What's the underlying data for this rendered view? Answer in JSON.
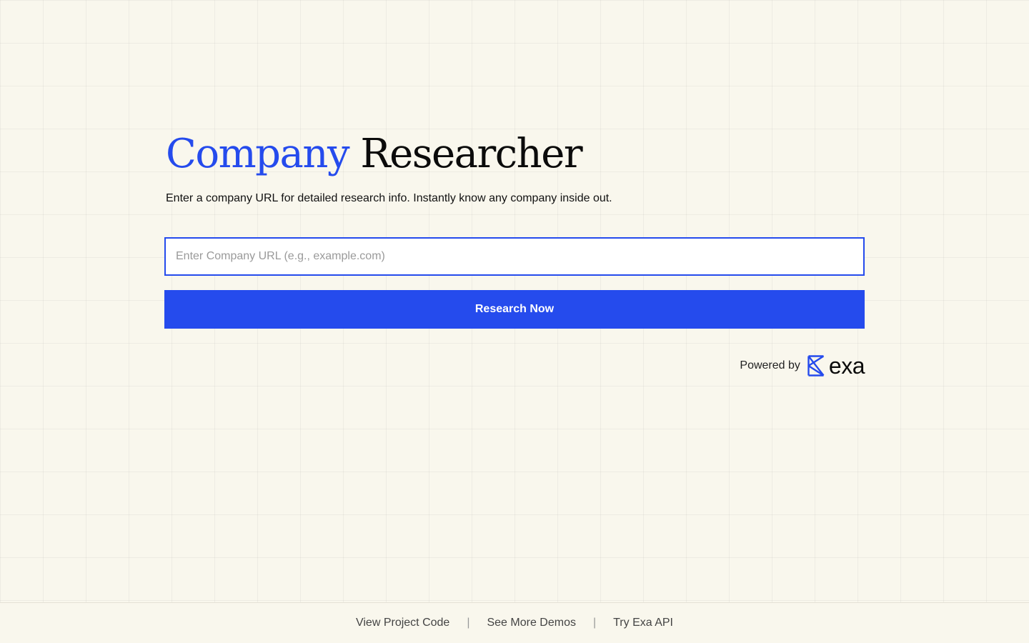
{
  "header": {
    "title_accent": "Company",
    "title_rest": "Researcher",
    "subtitle": "Enter a company URL for detailed research info. Instantly know any company inside out."
  },
  "search": {
    "value": "",
    "placeholder": "Enter Company URL (e.g., example.com)"
  },
  "actions": {
    "research_label": "Research Now"
  },
  "powered_by": {
    "label": "Powered by",
    "brand": "exa",
    "icon": "exa-logo-icon"
  },
  "footer": {
    "links": [
      {
        "label": "View Project Code"
      },
      {
        "label": "See More Demos"
      },
      {
        "label": "Try Exa API"
      }
    ],
    "separator": "|"
  },
  "colors": {
    "accent": "#254bed",
    "background": "#f9f7ed"
  }
}
